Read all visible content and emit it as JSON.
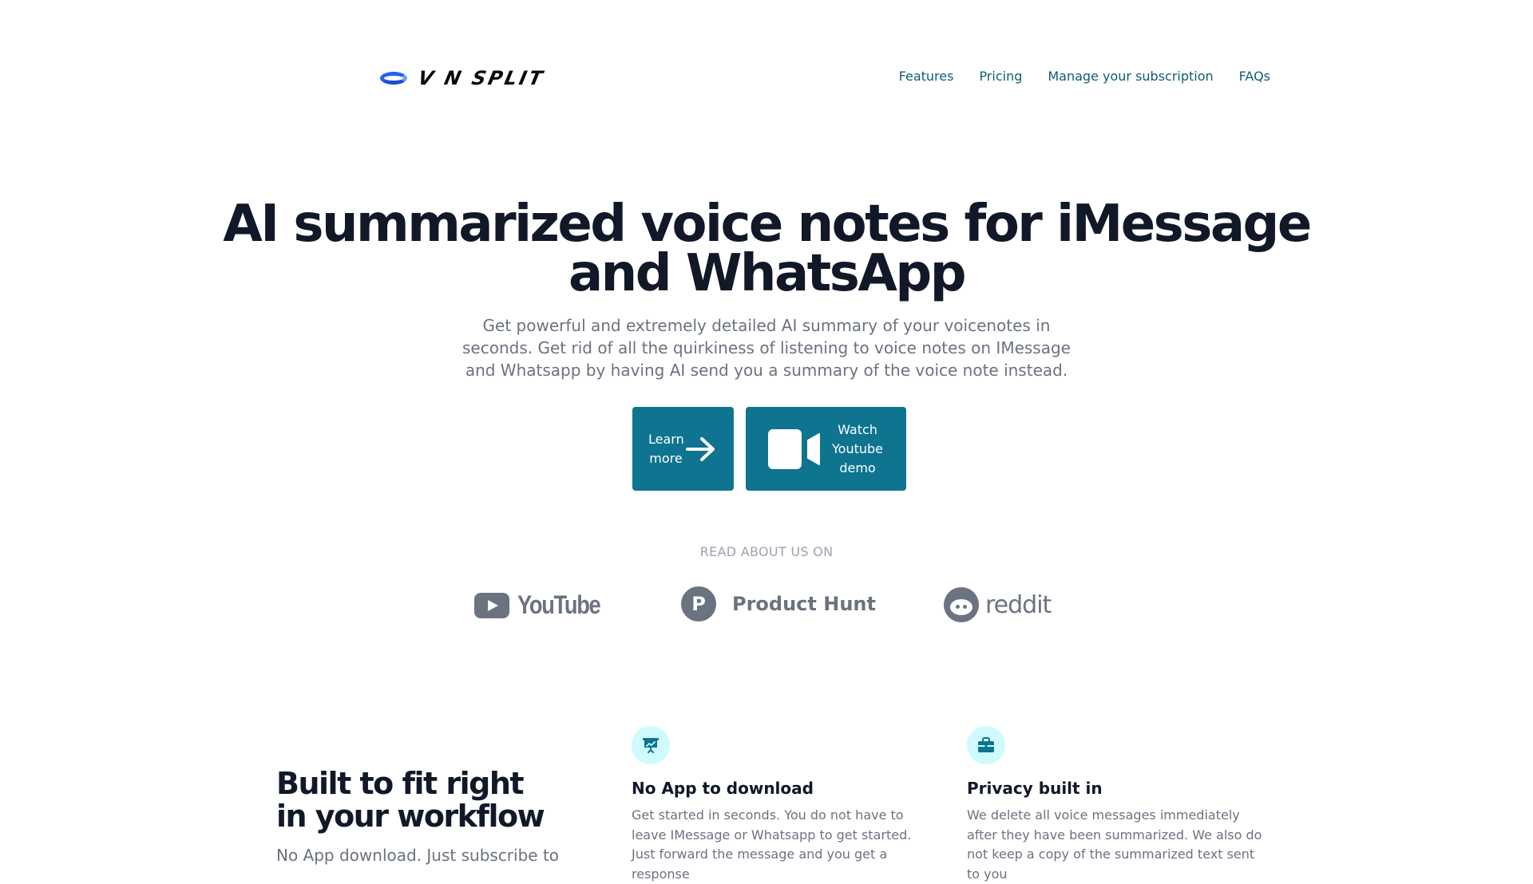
{
  "header": {
    "brand": "V N SPLIT",
    "nav": [
      "Features",
      "Pricing",
      "Manage your subscription",
      "FAQs"
    ]
  },
  "hero": {
    "title_line1": "AI summarized voice notes for iMessage",
    "title_line2": "and WhatsApp",
    "subtitle": "Get powerful and extremely detailed AI summary of your voicenotes in seconds. Get rid of all the quirkiness of listening to voice notes on IMessage and Whatsapp by having AI send you a summary of the voice note instead.",
    "learn_more": "Learn more",
    "watch_demo": "Watch Youtube demo"
  },
  "press": {
    "heading": "READ ABOUT US ON",
    "brands": [
      "YouTube",
      "Product Hunt",
      "reddit"
    ]
  },
  "features": {
    "title": "Built to fit right in your workflow",
    "subtitle": "No App download. Just subscribe to",
    "items": [
      {
        "icon": "presentation-chart-icon",
        "title": "No App to download",
        "body": "Get started in seconds. You do not have to leave IMessage or Whatsapp to get started. Just forward the message and you get a response"
      },
      {
        "icon": "briefcase-icon",
        "title": "Privacy built in",
        "body": "We delete all voice messages immediately after they have been summarized. We also do not keep a copy of the summarized text sent to you"
      }
    ]
  },
  "colors": {
    "accent": "#0e7490",
    "nav_link": "#0e5f70",
    "icon_bg": "#cffafe"
  }
}
